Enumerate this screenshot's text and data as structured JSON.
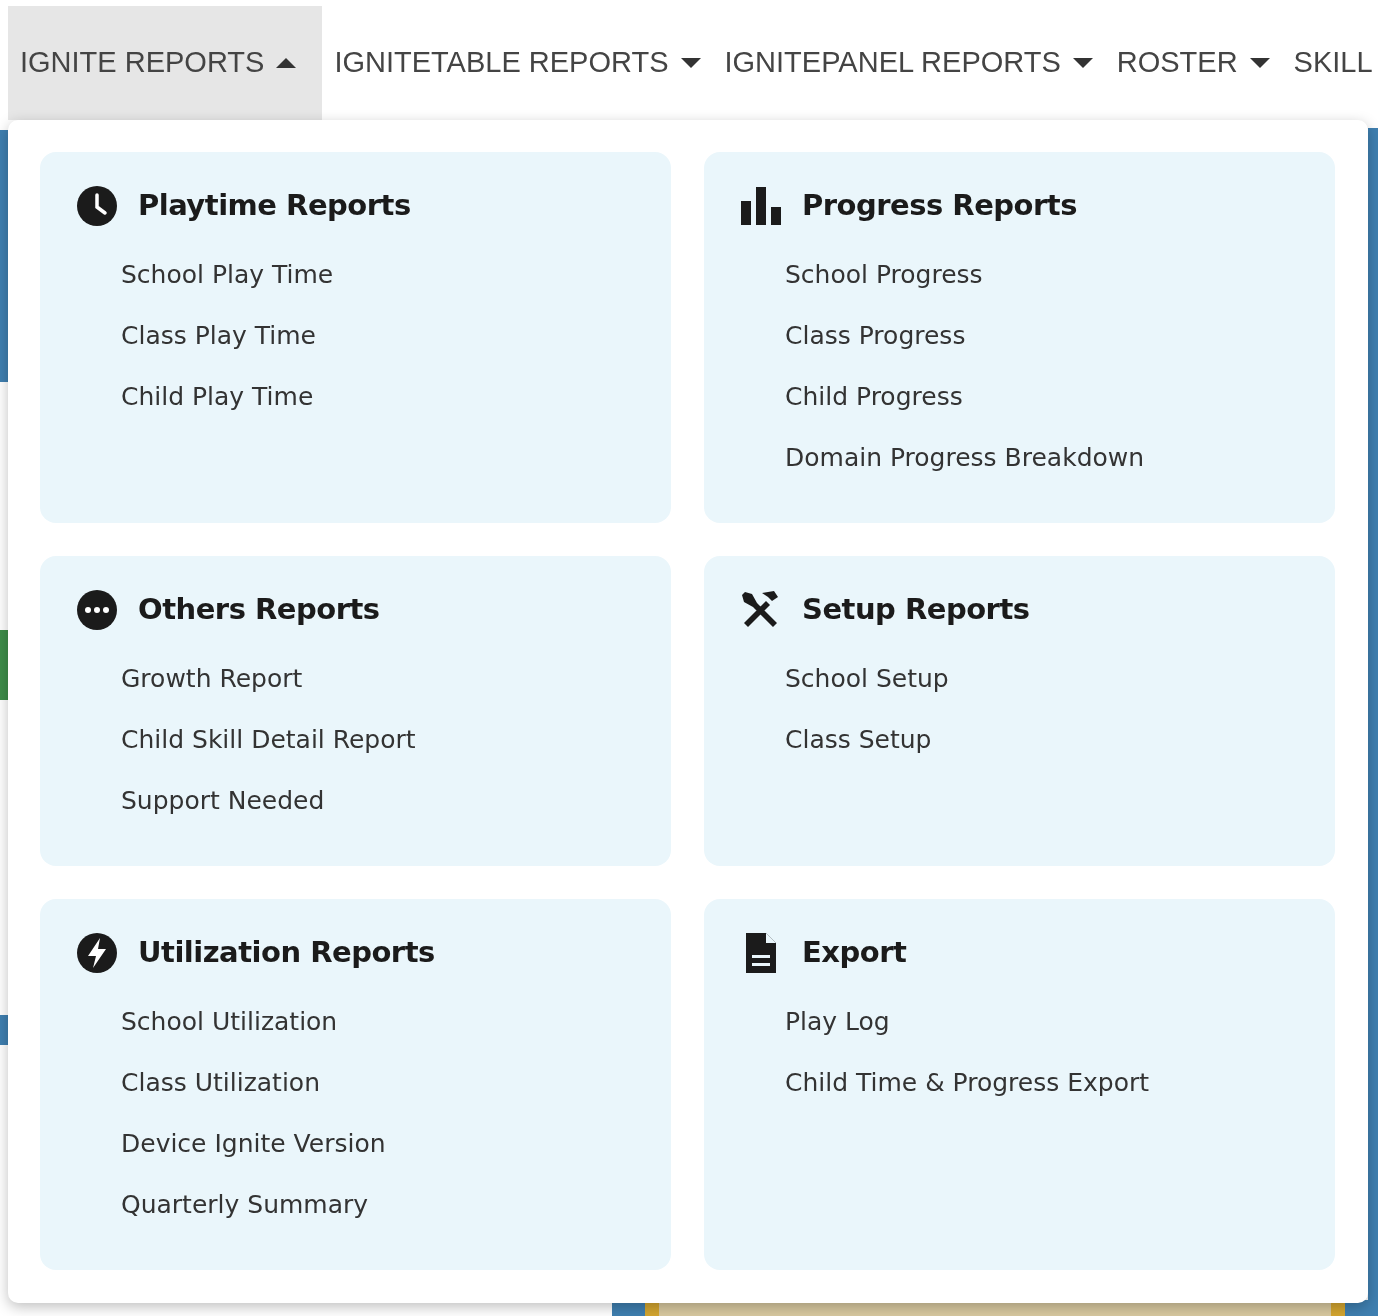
{
  "nav": [
    {
      "label": "IGNITE REPORTS",
      "expanded": true
    },
    {
      "label": "IGNITETABLE REPORTS",
      "expanded": false
    },
    {
      "label": "IGNITEPANEL REPORTS",
      "expanded": false
    },
    {
      "label": "ROSTER",
      "expanded": false
    },
    {
      "label": "SKILL",
      "expanded": false
    }
  ],
  "sections": [
    {
      "title": "Playtime Reports",
      "kind": "clock",
      "items": [
        "School Play Time",
        "Class Play Time",
        "Child Play Time"
      ]
    },
    {
      "title": "Progress Reports",
      "kind": "chart",
      "items": [
        "School Progress",
        "Class Progress",
        "Child Progress",
        "Domain Progress Breakdown"
      ]
    },
    {
      "title": "Others Reports",
      "kind": "more",
      "items": [
        "Growth Report",
        "Child Skill Detail Report",
        "Support Needed"
      ]
    },
    {
      "title": "Setup Reports",
      "kind": "tools",
      "items": [
        "School Setup",
        "Class Setup"
      ]
    },
    {
      "title": "Utilization Reports",
      "kind": "bolt",
      "items": [
        "School Utilization",
        "Class Utilization",
        "Device Ignite Version",
        "Quarterly Summary"
      ]
    },
    {
      "title": "Export",
      "kind": "file",
      "items": [
        "Play Log",
        "Child Time & Progress Export"
      ]
    }
  ]
}
